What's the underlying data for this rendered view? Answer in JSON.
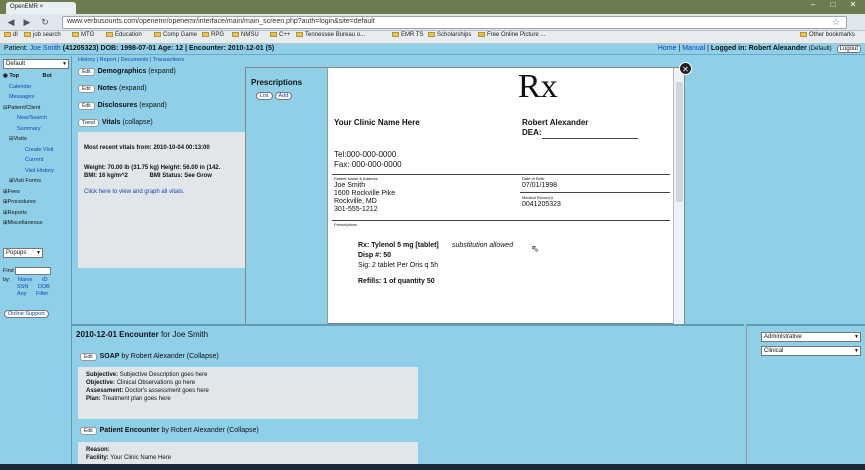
{
  "browser": {
    "tab_title": "OpenEMR",
    "url": "www.verbusounts.com/openemr/openemr/interface/main/main_screen.php?auth=login&site=default",
    "bookmarks": [
      "dl",
      "job search",
      "MTG",
      "Education",
      "Comp Game",
      "RPG",
      "NMSU",
      "C++",
      "Tennessee Bureau o...",
      "EMR TS",
      "Scholarships",
      "Free Online Picture ..."
    ],
    "other_bookmarks": "Other bookmarks"
  },
  "header": {
    "patient_label": "Patient:",
    "patient_name": "Joe Smith",
    "patient_details": "(41205323) DOB: 1998-07-01 Age: 12 | Encounter: 2010-12-01 (5)",
    "subnav": "History | Report | Documents | Transactions",
    "home": "Home",
    "manual": "Manual",
    "logged_in": "Logged in: Robert Alexander",
    "site": "(Default)",
    "logout": "Logout"
  },
  "sidebar": {
    "select_value": "Default",
    "top_label": "Top",
    "bot_label": "Bot",
    "items": [
      "Calendar",
      "Messages",
      "Patient/Client",
      "New/Search",
      "Summary",
      "Visits",
      "Create Visit",
      "Current",
      "Visit History",
      "Visit Forms",
      "Fees",
      "Procedures",
      "Reports",
      "Miscellaneous"
    ],
    "popups_value": "Popups",
    "find_label": "Find",
    "by_label": "by:",
    "find_options": [
      "Name",
      "ID",
      "SSN",
      "DOB",
      "Any",
      "Filter"
    ],
    "online_support": "Online Support"
  },
  "main": {
    "sections": [
      {
        "btn": "Edit",
        "title": "Demographics",
        "toggle": "(expand)"
      },
      {
        "btn": "Edit",
        "title": "Notes",
        "toggle": "(expand)"
      },
      {
        "btn": "Edit",
        "title": "Disclosures",
        "toggle": "(expand)"
      },
      {
        "btn": "Trend",
        "title": "Vitals",
        "toggle": "(collapse)"
      }
    ],
    "vitals_recent": "Most recent vitals from: 2010-10-04 00:13:00",
    "weight": "Weight: 70.00 lb (31.75 kg)",
    "height": "Height: 56.00 in (142.",
    "bmi": "BMI: 16 kg/m^2",
    "bmi_status": "BMI Status: See Grow",
    "vitals_link": "Click here to view and graph all vitals."
  },
  "prescriptions": {
    "title": "Prescriptions",
    "list_btn": "List",
    "add_btn": "Add",
    "rx_symbol": "Rx",
    "clinic_name": "Your Clinic Name Here",
    "doctor": "Robert Alexander",
    "dea": "DEA:",
    "tel": "Tel:000-000-0000",
    "fax": "Fax: 000-000-0000",
    "patient_label": "Patient Name & Address",
    "patient_name": "Joe Smith",
    "addr1": "1600 Rockville Pike",
    "addr2": "Rockville, MD",
    "phone": "301-555-1212",
    "dob_label": "Date of Birth",
    "dob": "07/01/1998",
    "mrn_label": "Medical Record #",
    "mrn": "0041205323",
    "rx_section_label": "Prescriptions",
    "rx_drug": "Rx: Tylenol 5 mg [tablet]",
    "substitution": "substitution allowed",
    "disp": "Disp #: 50",
    "sig": "Sig: 2 tablet Per Oris q 5h",
    "refills": "Refills: 1 of quantity 50"
  },
  "encounter": {
    "date": "2010-12-01 Encounter",
    "for": "for Joe Smith",
    "soap_btn": "Edit",
    "soap_title": "SOAP",
    "soap_by": "by Robert Alexander (Collapse)",
    "subjective": "Subjective:",
    "subjective_val": "Subjective Description goes here",
    "objective": "Objective:",
    "objective_val": "Clinical Observations go here",
    "assessment": "Assessment:",
    "assessment_val": "Doctor's assessment goes here",
    "plan": "Plan:",
    "plan_val": "Treatment plan goes here",
    "pe_btn": "Edit",
    "pe_title": "Patient Encounter",
    "pe_by": "by Robert Alexander (Collapse)",
    "reason": "Reason:",
    "facility": "Facility:",
    "facility_val": "Your Clinic Name Here"
  },
  "right_panel": {
    "select1": "Administrative",
    "select2": "Clinical"
  }
}
